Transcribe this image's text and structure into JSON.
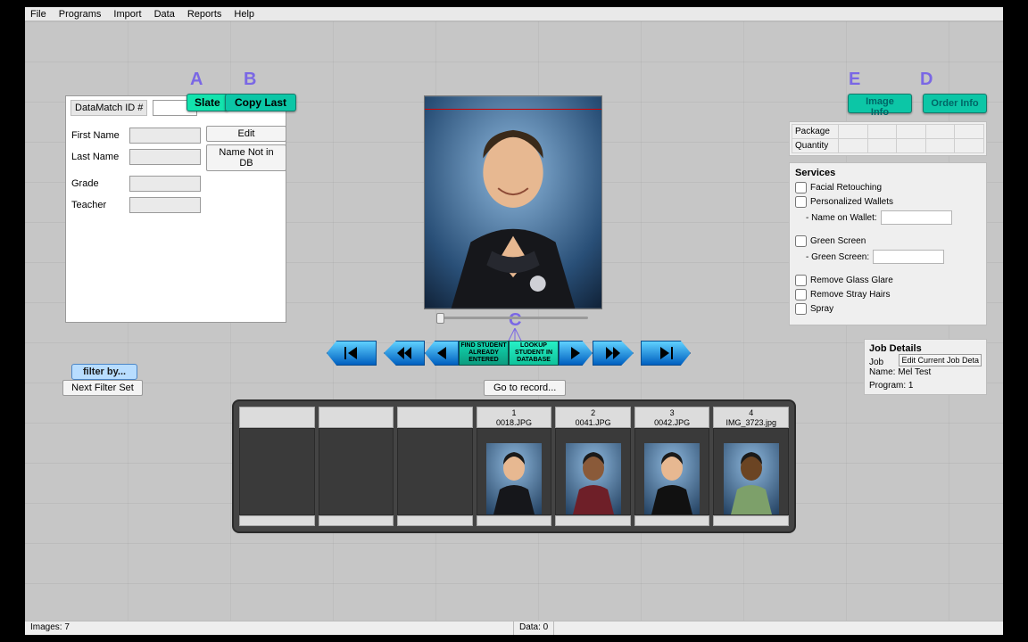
{
  "menu": [
    "File",
    "Programs",
    "Import",
    "Data",
    "Reports",
    "Help"
  ],
  "annotations": {
    "A": "A",
    "B": "B",
    "C": "C",
    "D": "D",
    "E": "E"
  },
  "left": {
    "header_label": "DataMatch ID #",
    "id_value": "",
    "fields": {
      "first_name_label": "First Name",
      "first_name": "",
      "last_name_label": "Last Name",
      "last_name": "",
      "grade_label": "Grade",
      "grade": "",
      "teacher_label": "Teacher",
      "teacher": ""
    }
  },
  "buttons": {
    "slate": "Slate",
    "copy_last": "Copy Last",
    "edit": "Edit",
    "name_not_in_db": "Name Not in DB",
    "filter_by": "filter by...",
    "next_filter": "Next Filter Set",
    "go_to": "Go to record...",
    "image_info": "Image Info",
    "order_info": "Order Info",
    "edit_job": "Edit Current Job Deta"
  },
  "nav": {
    "find_student": "FIND STUDENT\nALREADY\nENTERED",
    "lookup_student": "LOOKUP\nSTUDENT IN\nDATABASE"
  },
  "right": {
    "package_label": "Package",
    "quantity_label": "Quantity",
    "services_title": "Services",
    "services": {
      "facial": "Facial Retouching",
      "pwallets": "Personalized Wallets",
      "name_on_wallet_label": "- Name on Wallet:",
      "name_on_wallet": "",
      "green": "Green Screen",
      "green_sub_label": "- Green Screen:",
      "green_val": "",
      "glass": "Remove Glass Glare",
      "stray": "Remove Stray Hairs",
      "spray": "Spray"
    },
    "job_details_title": "Job Details",
    "job_name_label": "Job Name:",
    "job_name": "Mel Test",
    "program_label": "Program:",
    "program": "1"
  },
  "thumbs": [
    {
      "idx": "",
      "file": ""
    },
    {
      "idx": "",
      "file": ""
    },
    {
      "idx": "",
      "file": ""
    },
    {
      "idx": "1",
      "file": "0018.JPG"
    },
    {
      "idx": "2",
      "file": "0041.JPG"
    },
    {
      "idx": "3",
      "file": "0042.JPG"
    },
    {
      "idx": "4",
      "file": "IMG_3723.jpg"
    }
  ],
  "status": {
    "images": "Images: 7",
    "data": "Data: 0"
  },
  "colors": {
    "teal": "#0cc6a6",
    "accent_blue": "#1f8cff"
  }
}
